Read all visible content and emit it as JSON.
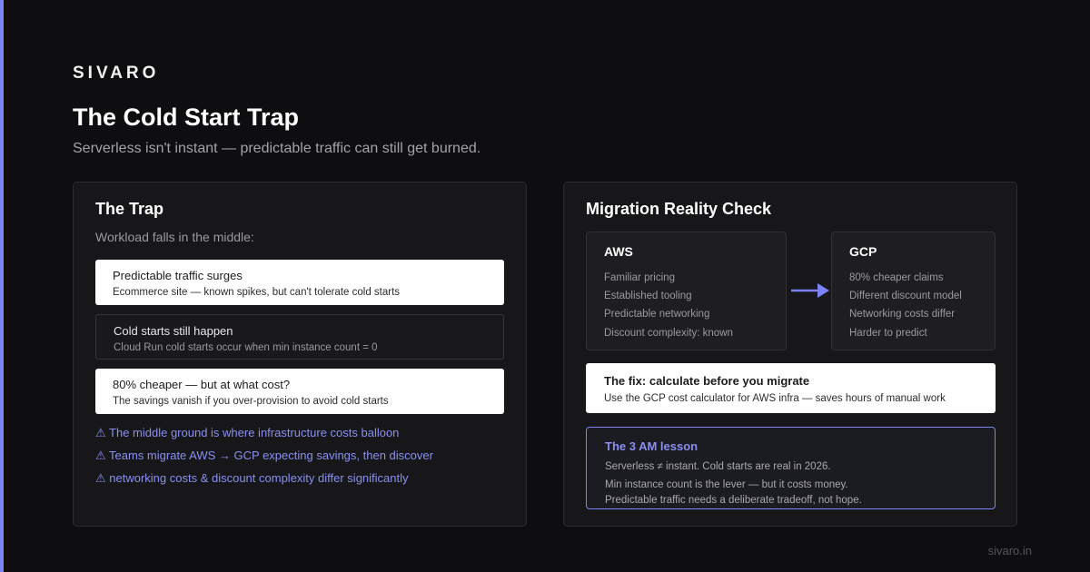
{
  "brand": "SIVARO",
  "title": "The Cold Start Trap",
  "subtitle": "Serverless isn't instant — predictable traffic can still get burned.",
  "colors": {
    "accent": "#7c83f5",
    "background": "#0e0e10",
    "panel": "#17171a",
    "card_light": "#ffffff",
    "warning": "#8a8ff0"
  },
  "trap": {
    "title": "The Trap",
    "intro": "Workload falls in the middle:",
    "cards": [
      {
        "title": "Predictable traffic surges",
        "desc": "Ecommerce site — known spikes, but can't tolerate cold starts",
        "style": "light"
      },
      {
        "title": "Cold starts still happen",
        "desc": "Cloud Run cold starts occur when min instance count = 0",
        "style": "dark"
      },
      {
        "title": "80% cheaper — but at what cost?",
        "desc": "The savings vanish if you over-provision to avoid cold starts",
        "style": "light"
      }
    ],
    "warnings": [
      "⚠ The middle ground is where infrastructure costs balloon",
      "⚠ Teams migrate AWS → GCP expecting savings, then discover",
      "⚠ networking costs & discount complexity differ significantly"
    ]
  },
  "migration": {
    "title": "Migration Reality Check",
    "aws": {
      "name": "AWS",
      "lines": [
        "Familiar pricing",
        "Established tooling",
        "Predictable networking"
      ],
      "footer": "Discount complexity: known"
    },
    "arrow_icon": "arrow-right-icon",
    "gcp": {
      "name": "GCP",
      "lines": [
        "80% cheaper claims",
        "Different discount model",
        "Networking costs differ"
      ],
      "footer": "Harder to predict"
    },
    "fix": {
      "title": "The fix: calculate before you migrate",
      "desc": "Use the GCP cost calculator for AWS infra — saves hours of manual work"
    },
    "lesson": {
      "title": "The 3 AM lesson",
      "lines": [
        "Serverless ≠ instant. Cold starts are real in 2026.",
        "Min instance count is the lever — but it costs money.",
        "Predictable traffic needs a deliberate tradeoff, not hope."
      ]
    }
  },
  "footer": "sivaro.in"
}
